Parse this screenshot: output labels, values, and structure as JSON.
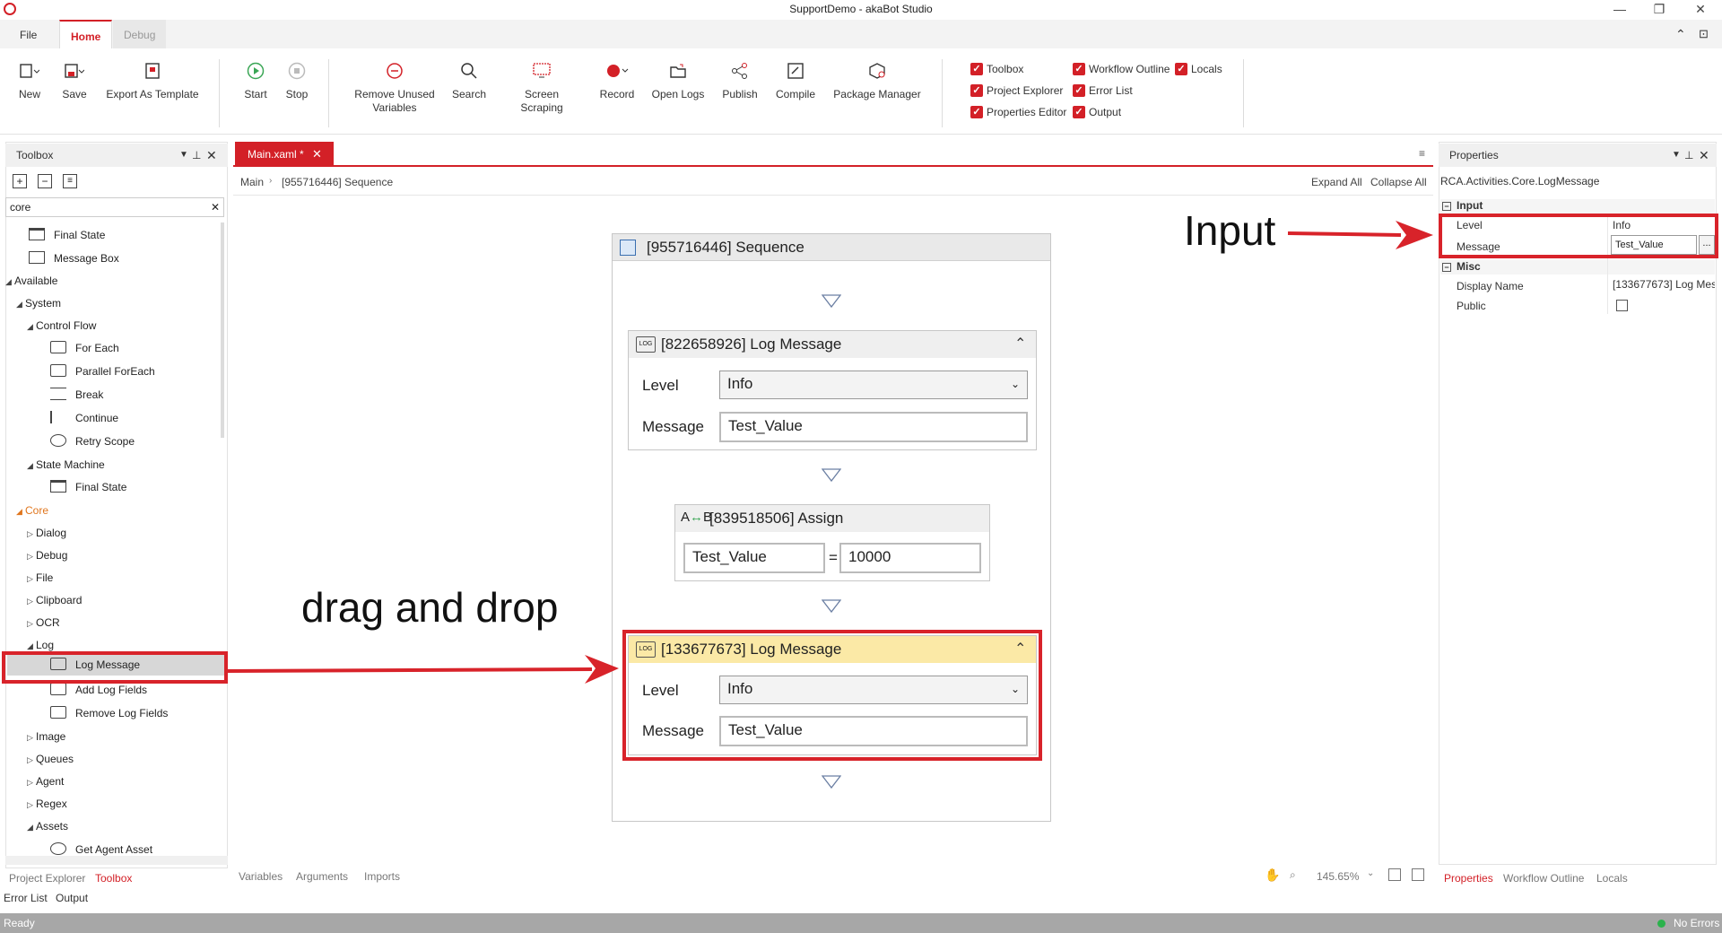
{
  "window": {
    "title": "SupportDemo - akaBot Studio"
  },
  "menu_tabs": [
    "File",
    "Home",
    "Debug"
  ],
  "ribbon": {
    "new": "New",
    "save": "Save",
    "export": "Export As Template",
    "start": "Start",
    "stop": "Stop",
    "remove_unused_1": "Remove Unused",
    "remove_unused_2": "Variables",
    "search": "Search",
    "screen_scraping": "Screen Scraping",
    "record": "Record",
    "open_logs": "Open Logs",
    "publish": "Publish",
    "compile": "Compile",
    "package_manager": "Package Manager",
    "toggles": {
      "toolbox": "Toolbox",
      "project_explorer": "Project Explorer",
      "properties_editor": "Properties Editor",
      "workflow_outline": "Workflow Outline",
      "error_list": "Error List",
      "output": "Output",
      "locals": "Locals"
    }
  },
  "toolbox": {
    "title": "Toolbox",
    "search_value": "core",
    "items": {
      "final_state_top": "Final State",
      "message_box": "Message Box",
      "available": "Available",
      "system": "System",
      "control_flow": "Control Flow",
      "for_each": "For Each",
      "parallel_foreach": "Parallel ForEach",
      "break": "Break",
      "continue": "Continue",
      "retry_scope": "Retry Scope",
      "state_machine": "State Machine",
      "final_state": "Final State",
      "core": "Core",
      "dialog": "Dialog",
      "debug": "Debug",
      "file": "File",
      "clipboard": "Clipboard",
      "ocr": "OCR",
      "log": "Log",
      "log_message": "Log Message",
      "add_log_fields": "Add Log Fields",
      "remove_log_fields": "Remove Log Fields",
      "image": "Image",
      "queues": "Queues",
      "agent": "Agent",
      "regex": "Regex",
      "assets": "Assets",
      "get_agent_asset": "Get Agent Asset"
    },
    "bottom_tabs": {
      "project_explorer": "Project Explorer",
      "toolbox": "Toolbox",
      "error_list": "Error List",
      "output": "Output"
    }
  },
  "designer": {
    "tab": "Main.xaml *",
    "breadcrumb": {
      "root": "Main",
      "current": "[955716446] Sequence"
    },
    "expand_all": "Expand All",
    "collapse_all": "Collapse All",
    "sequence_title": "[955716446] Sequence",
    "log1": {
      "title": "[822658926] Log Message",
      "level_label": "Level",
      "level": "Info",
      "message_label": "Message",
      "message": "Test_Value"
    },
    "assign": {
      "title": "[839518506] Assign",
      "to": "Test_Value",
      "eq": "=",
      "value": "10000"
    },
    "log2": {
      "title": "[133677673] Log Message",
      "level_label": "Level",
      "level": "Info",
      "message_label": "Message",
      "message": "Test_Value"
    },
    "bottom_tabs": {
      "variables": "Variables",
      "arguments": "Arguments",
      "imports": "Imports"
    },
    "zoom": "145.65%"
  },
  "annotations": {
    "drag_drop": "drag and drop",
    "input": "Input"
  },
  "properties": {
    "title": "Properties",
    "type_name": "RCA.Activities.Core.LogMessage",
    "input_group": "Input",
    "level_label": "Level",
    "level": "Info",
    "message_label": "Message",
    "message": "Test_Value",
    "ellipsis": "...",
    "misc_group": "Misc",
    "display_name_label": "Display Name",
    "display_name": "[133677673] Log Mes",
    "public_label": "Public",
    "bottom_tabs": {
      "properties": "Properties",
      "workflow_outline": "Workflow Outline",
      "locals": "Locals"
    }
  },
  "status": {
    "left": "Ready",
    "right": "No Errors"
  },
  "colors": {
    "accent": "#d32027",
    "highlight": "#fbe9a6",
    "status_bar": "#a7a7a7"
  }
}
